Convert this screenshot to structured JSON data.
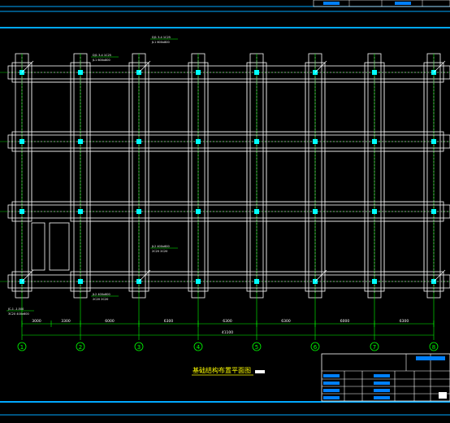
{
  "colors": {
    "background": "#000000",
    "frame": "#00a8ff",
    "structure": "#ffffff",
    "beam_hatch": "#ff40ff",
    "grid": "#00ff00",
    "cyan": "#00ffff",
    "text_yellow": "#ffff00",
    "title_block": "#ffffff",
    "title_fill": "#0080ff"
  },
  "drawing": {
    "title": "基础结构布置平面图",
    "total_dimension": "41100",
    "segment_dimensions": [
      "3000",
      "3300",
      "6000",
      "6300",
      "6300",
      "6300",
      "6000",
      "6300"
    ],
    "axis_labels": [
      "1",
      "2",
      "3",
      "4",
      "5",
      "6",
      "7",
      "8"
    ],
    "leaders": [
      {
        "line1": "DJ1 3-4 1C25",
        "line2": "JL1 600x800"
      },
      {
        "line1": "DJ1 3-4 1C25",
        "line2": "JL1 600x800"
      },
      {
        "line1": "JL2 400x600",
        "line2": "2C20 2C20"
      },
      {
        "line1": "JL2 400x600",
        "line2": "2C20 2C20"
      },
      {
        "line1": "JC-1 -1.500",
        "line2": "3C20 400x600"
      }
    ]
  },
  "title_block": {
    "rows": 5,
    "cols": 6
  }
}
